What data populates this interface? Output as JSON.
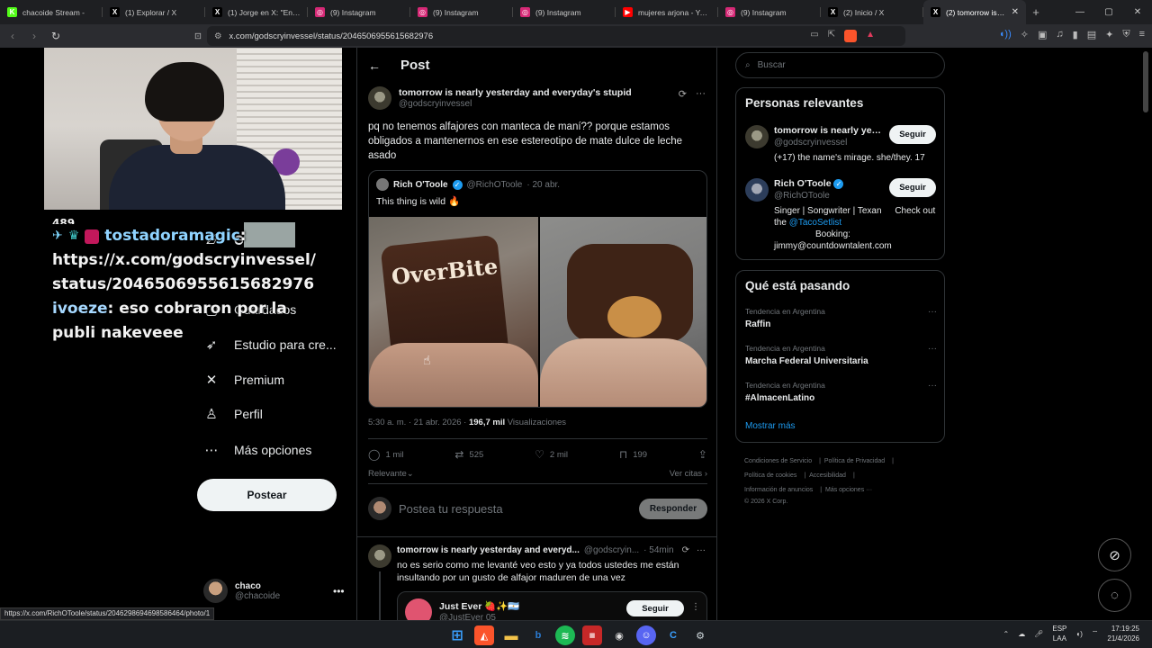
{
  "browser": {
    "tabs": [
      {
        "label": "chacoide Stream -",
        "favicon_color": "#53fc18",
        "favicon_glyph": "K",
        "active": false
      },
      {
        "label": "(1) Explorar / X",
        "favicon_color": "#000000",
        "favicon_glyph": "X",
        "active": false
      },
      {
        "label": "(1) Jorge en X: \"Entre n",
        "favicon_color": "#000000",
        "favicon_glyph": "X",
        "active": false
      },
      {
        "label": "(9) Instagram",
        "favicon_color": "#d62976",
        "favicon_glyph": "◎",
        "active": false
      },
      {
        "label": "(9) Instagram",
        "favicon_color": "#d62976",
        "favicon_glyph": "◎",
        "active": false
      },
      {
        "label": "(9) Instagram",
        "favicon_color": "#d62976",
        "favicon_glyph": "◎",
        "active": false
      },
      {
        "label": "mujeres arjona - YouTu",
        "favicon_color": "#ff0000",
        "favicon_glyph": "▶",
        "active": false
      },
      {
        "label": "(9) Instagram",
        "favicon_color": "#d62976",
        "favicon_glyph": "◎",
        "active": false
      },
      {
        "label": "(2) Inicio / X",
        "favicon_color": "#000000",
        "favicon_glyph": "X",
        "active": false
      },
      {
        "label": "(2) tomorrow is ne",
        "favicon_color": "#000000",
        "favicon_glyph": "X",
        "active": true
      }
    ],
    "url": "x.com/godscryinvessel/status/2046506955615682976",
    "status_link": "https://x.com/RichOToole/status/2046298694698586464/photo/1"
  },
  "stream_overlay": {
    "chat": [
      {
        "user": "tostadoramagic",
        "message": "https://x.com/godscryinvessel/status/2046506955615682976"
      },
      {
        "user": "ivoeze",
        "message": "eso cobraron por la publi nakeveee"
      }
    ],
    "partial_top": "489"
  },
  "sidebar": {
    "items": [
      {
        "label": "Grok",
        "icon": "grok-icon",
        "glyph": "⟋"
      },
      {
        "label": "Guardados",
        "icon": "bookmark-icon",
        "glyph": "▢"
      },
      {
        "label": "Estudio para cre...",
        "icon": "rocket-icon",
        "glyph": "➶"
      },
      {
        "label": "Premium",
        "icon": "x-logo-icon",
        "glyph": "✕"
      },
      {
        "label": "Perfil",
        "icon": "person-icon",
        "glyph": "♙"
      },
      {
        "label": "Más opciones",
        "icon": "more-icon",
        "glyph": "⋯"
      }
    ],
    "partial_chat_item": "Ch",
    "post_button": "Postear",
    "account": {
      "name": "chaco",
      "handle": "@chacoide"
    }
  },
  "post": {
    "header_title": "Post",
    "author_name": "tomorrow is nearly yesterday and everyday's stupid",
    "author_handle": "@godscryinvessel",
    "text": "pq no tenemos alfajores con manteca de maní?? porque estamos obligados a mantenernos en ese estereotipo de mate dulce de leche asado",
    "quote": {
      "name": "Rich O'Toole",
      "handle": "@RichOToole",
      "time": "· 20 abr.",
      "text": "This thing is wild 🔥",
      "image_label": "OverBite"
    },
    "timestamp": "5:30 a. m. · 21 abr. 2026 ·",
    "views_count": "196,7 mil",
    "views_label": "Visualizaciones",
    "stats": {
      "replies": "1 mil",
      "reposts": "525",
      "likes": "2 mil",
      "bookmarks": "199"
    },
    "sort_label": "Relevante",
    "quotes_link": "Ver citas",
    "reply_placeholder": "Postea tu respuesta",
    "reply_button": "Responder"
  },
  "reply_tweet": {
    "name": "tomorrow is nearly yesterday and everyd...",
    "handle": "@godscryin...",
    "time": "· 54min",
    "text": "no es serio como me levanté veo esto y ya todos ustedes me están insultando por un gusto de alfajor maduren de una vez",
    "card": {
      "name": "Just Ever 🍓✨🇦🇷",
      "handle": "@JustEver 05",
      "follow": "Seguir"
    }
  },
  "right": {
    "search_placeholder": "Buscar",
    "relevant_title": "Personas relevantes",
    "people": [
      {
        "name": "tomorrow is nearly yes...",
        "handle": "@godscryinvessel",
        "bio": "(+17) the name's mirage. she/they. 17",
        "follow": "Seguir"
      },
      {
        "name": "Rich O'Toole",
        "handle": "@RichOToole",
        "bio_pre": "Singer | Songwriter | Texan",
        "bio_extra": "Check out",
        "bio_link": "@TacoSetlist",
        "bio_post": "Booking:",
        "bio_mail": "jimmy@countdowntalent.com",
        "follow": "Seguir"
      }
    ],
    "trends_title": "Qué está pasando",
    "trends": [
      {
        "context": "Tendencia en Argentina",
        "name": "Raffin"
      },
      {
        "context": "Tendencia en Argentina",
        "name": "Marcha Federal Universitaria"
      },
      {
        "context": "Tendencia en Argentina",
        "name": "#AlmacenLatino"
      }
    ],
    "show_more": "Mostrar más",
    "footer": {
      "l1a": "Condiciones de Servicio",
      "l1b": "Política de Privacidad",
      "l2a": "Política de cookies",
      "l2b": "Accesibilidad",
      "l3a": "Información de anuncios",
      "l3b": "Más opciones ···",
      "copy": "© 2026 X Corp."
    }
  },
  "taskbar": {
    "lang1": "ESP",
    "lang2": "LAA",
    "time": "17:19:25",
    "date": "21/4/2026"
  },
  "colors": {
    "accent": "#1d9bf0",
    "background": "#000000",
    "border": "#2f3336"
  }
}
